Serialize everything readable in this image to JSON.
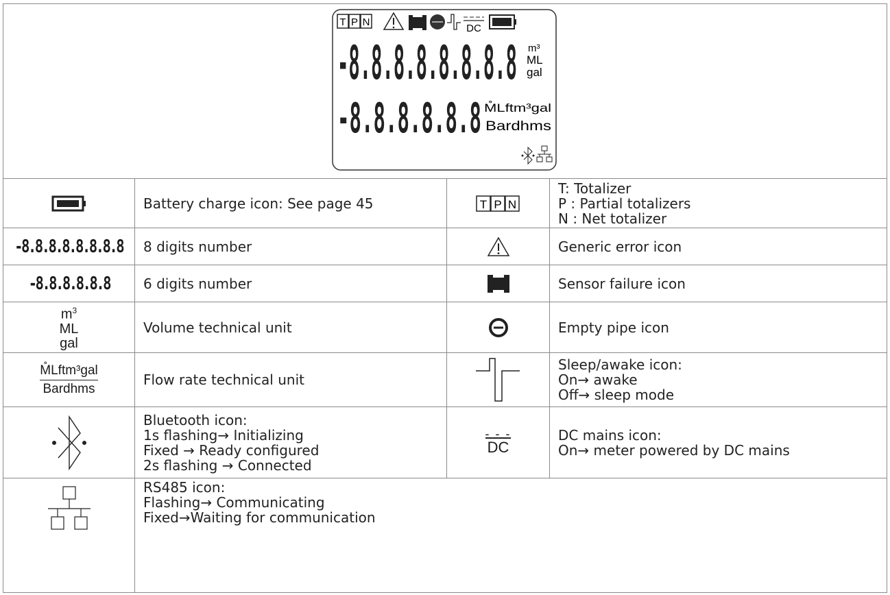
{
  "lcd": {
    "tpn_letters": [
      "T",
      "P",
      "N"
    ],
    "dc_label": "DC",
    "big_digits": "-8.8.8.8.8.8.8.8",
    "small_digits": "-8.8.8.8.8.8",
    "vol_units": [
      "m³",
      "ML",
      "gal"
    ],
    "flow_units_top": "M̊Lftm³gal",
    "flow_units_bottom": "Bardhms"
  },
  "rows": {
    "battery": {
      "desc": "Battery charge icon: See page 45",
      "icon": "battery-icon"
    },
    "tpn": {
      "letters": [
        "T",
        "P",
        "N"
      ],
      "desc": "T: Totalizer\nP : Partial totalizers\nN : Net totalizer"
    },
    "eight_digits": {
      "sample": "-8.8.8.8.8.8.8.8",
      "desc": "8 digits number"
    },
    "generic_error": {
      "desc": "Generic error icon",
      "icon": "warning-icon"
    },
    "six_digits": {
      "sample": "-8.8.8.8.8.8",
      "desc": "6 digits number"
    },
    "sensor_failure": {
      "desc": "Sensor failure icon",
      "icon": "sensor-failure-icon"
    },
    "volume_unit": {
      "units": [
        "m",
        "ML",
        "gal"
      ],
      "sup": "3",
      "desc": "Volume technical unit"
    },
    "empty_pipe": {
      "desc": "Empty pipe icon",
      "icon": "empty-pipe-icon"
    },
    "flow_unit": {
      "top": "M̊Lftm³gal",
      "bottom": "Bardhms",
      "desc": "Flow rate technical unit"
    },
    "sleep_awake": {
      "desc": "Sleep/awake icon:\nOn→ awake\nOff→ sleep mode",
      "icon": "sleep-awake-icon"
    },
    "bluetooth": {
      "desc": "Bluetooth icon:\n1s flashing→ Initializing\nFixed → Ready configured\n2s flashing → Connected",
      "icon": "bluetooth-icon"
    },
    "dc_mains": {
      "dash": "- - -",
      "label": "DC",
      "desc": "DC mains icon:\nOn→ meter powered by DC mains"
    },
    "rs485": {
      "desc": "RS485 icon:\nFlashing→ Communicating\nFixed→Waiting for communication",
      "icon": "network-icon"
    }
  },
  "colors": {
    "border": "#8a8a8a",
    "ink": "#1a1a1a"
  }
}
